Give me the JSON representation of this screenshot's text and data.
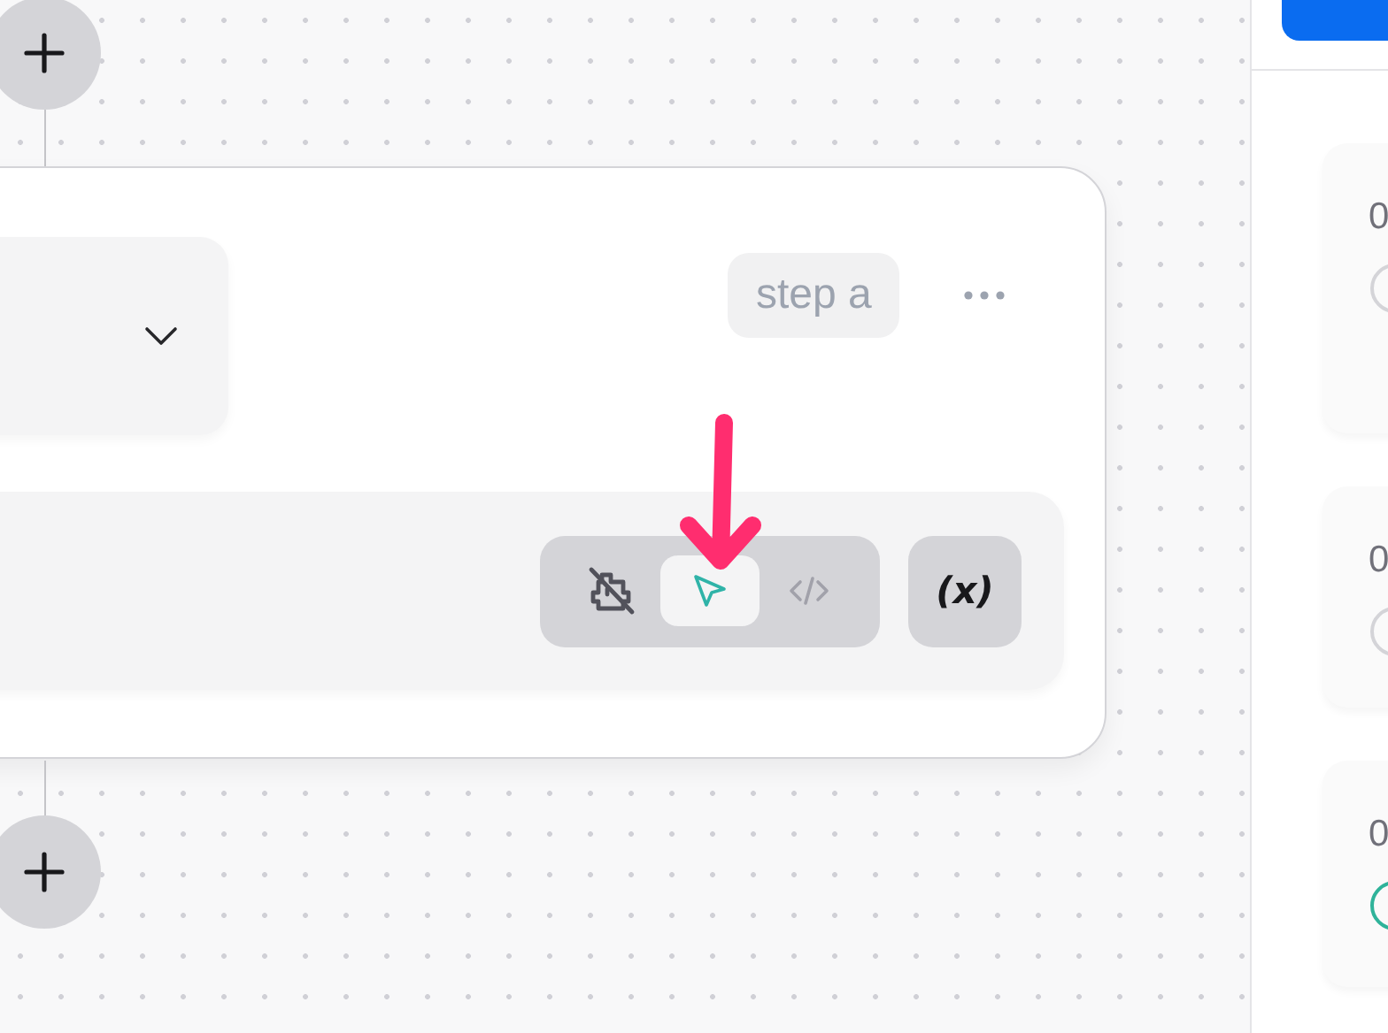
{
  "node": {
    "badge": "step a",
    "modes": [
      {
        "kind": "robot-off",
        "selected": false
      },
      {
        "kind": "cursor",
        "selected": true
      },
      {
        "kind": "code",
        "selected": false
      }
    ],
    "variable_button": "(x)"
  },
  "sidebar": {
    "cards": [
      {
        "label": "0",
        "color": "#d4d4d8"
      },
      {
        "label": "0",
        "color": "#d4d4d8"
      },
      {
        "label": "0",
        "color": "#2fb39a"
      }
    ]
  },
  "annotation": {
    "kind": "arrow"
  }
}
